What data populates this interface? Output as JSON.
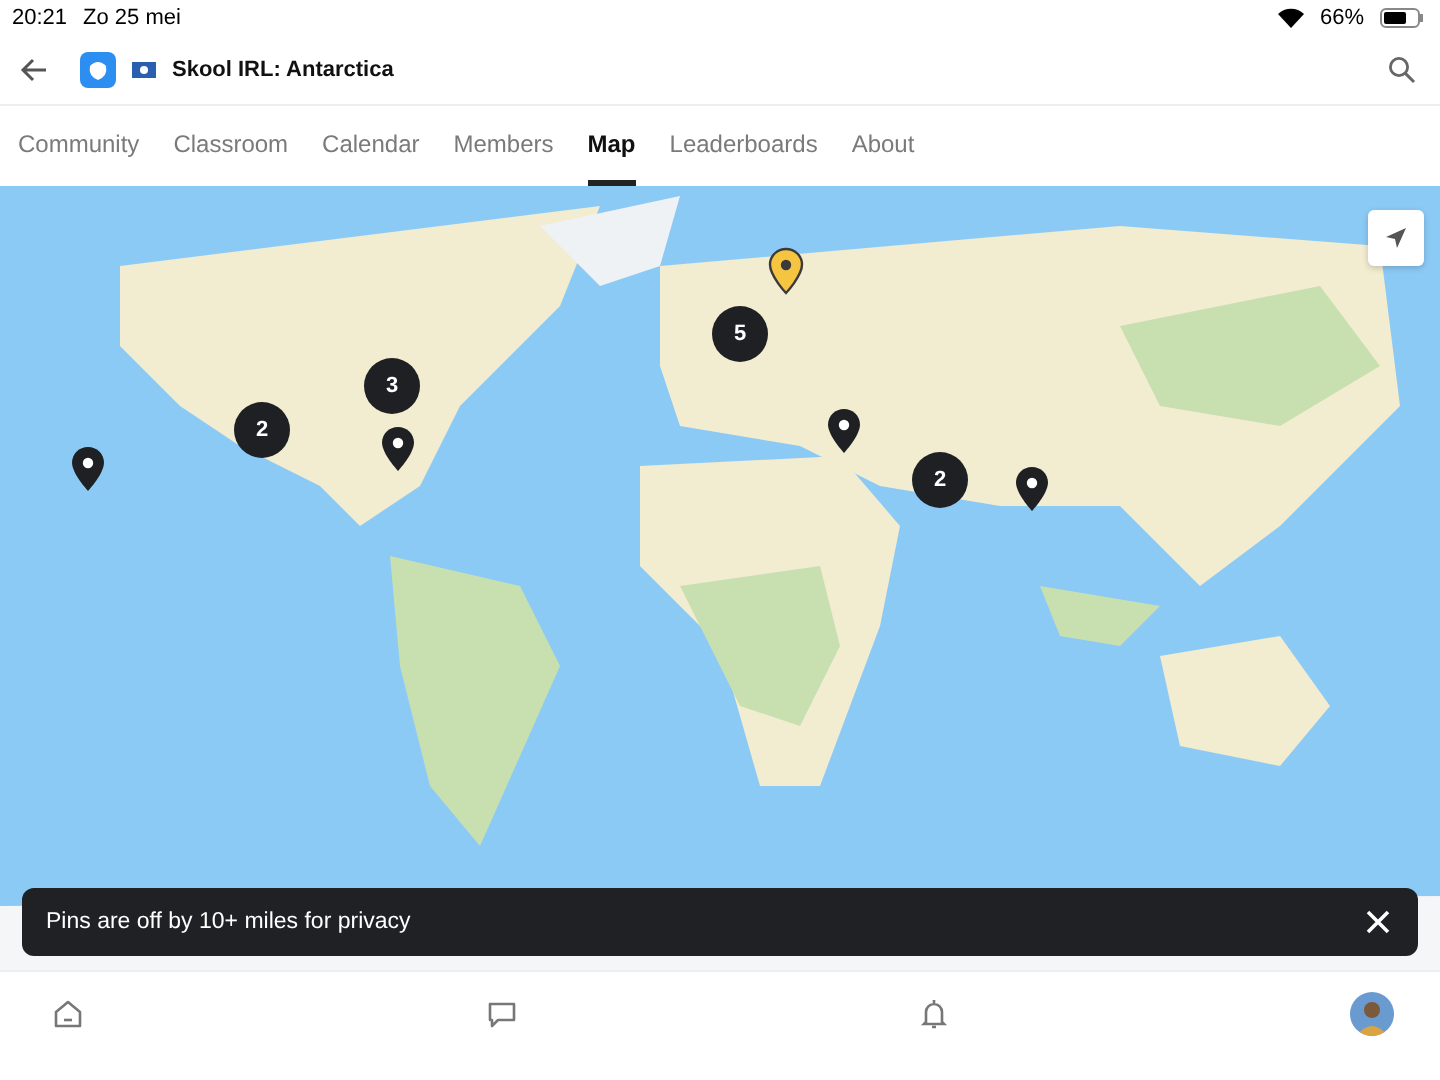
{
  "status_bar": {
    "time": "20:21",
    "date": "Zo 25 mei",
    "battery": "66%"
  },
  "header": {
    "title": "Skool IRL: Antarctica"
  },
  "tabs": [
    {
      "label": "Community",
      "selected": false
    },
    {
      "label": "Classroom",
      "selected": false
    },
    {
      "label": "Calendar",
      "selected": false
    },
    {
      "label": "Members",
      "selected": false
    },
    {
      "label": "Map",
      "selected": true
    },
    {
      "label": "Leaderboards",
      "selected": false
    },
    {
      "label": "About",
      "selected": false
    }
  ],
  "map": {
    "markers": [
      {
        "kind": "pin",
        "selected": false
      },
      {
        "kind": "cluster",
        "count": "2"
      },
      {
        "kind": "cluster",
        "count": "3"
      },
      {
        "kind": "pin",
        "selected": false
      },
      {
        "kind": "cluster",
        "count": "5"
      },
      {
        "kind": "pin",
        "selected": true
      },
      {
        "kind": "pin",
        "selected": false
      },
      {
        "kind": "cluster",
        "count": "2"
      },
      {
        "kind": "pin",
        "selected": false
      }
    ]
  },
  "toast": {
    "message": "Pins are off by 10+ miles for privacy"
  }
}
